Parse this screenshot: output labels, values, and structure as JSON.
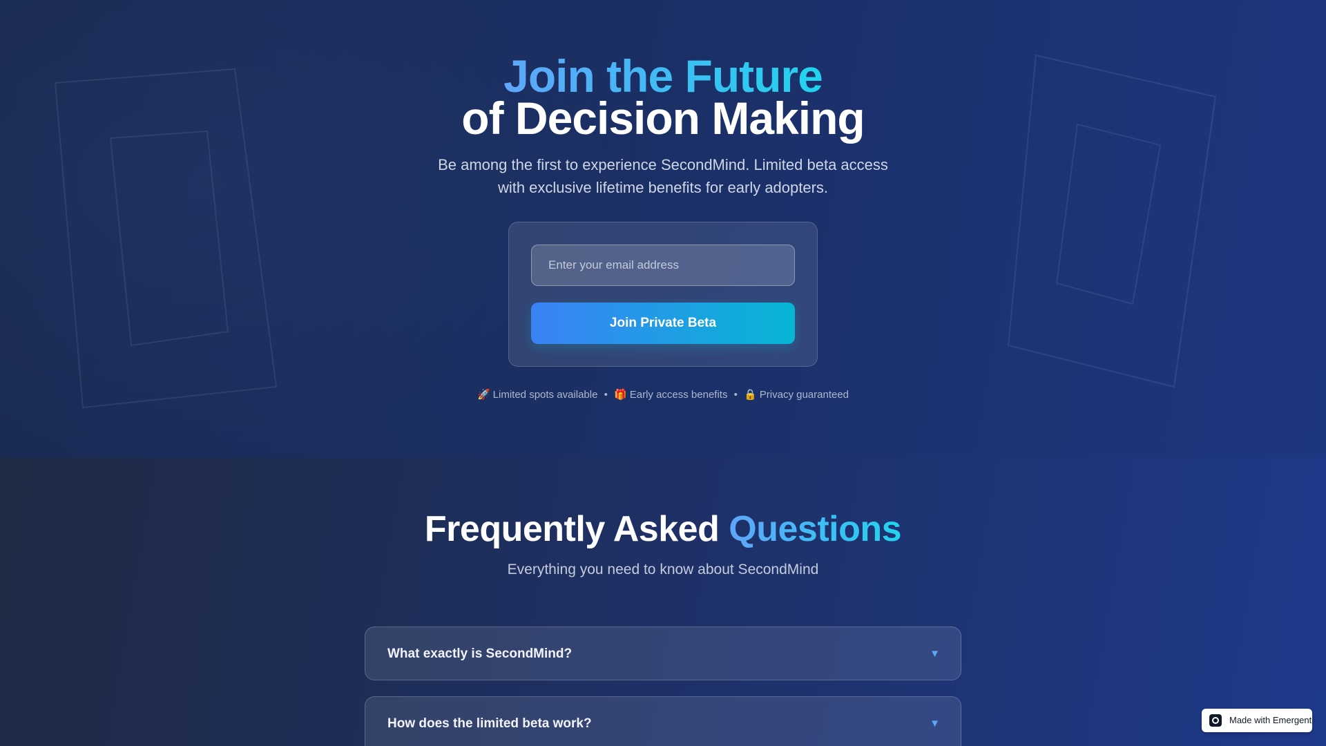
{
  "hero": {
    "title_line1": "Join the Future",
    "title_line2": "of Decision Making",
    "subtitle": "Be among the first to experience SecondMind. Limited beta access with exclusive lifetime benefits for early adopters.",
    "email_placeholder": "Enter your email address",
    "email_value": "",
    "cta_label": "Join Private Beta",
    "perks": [
      {
        "icon": "rocket-icon",
        "glyph": "🚀",
        "label": "Limited spots available"
      },
      {
        "icon": "gift-icon",
        "glyph": "🎁",
        "label": "Early access benefits"
      },
      {
        "icon": "lock-icon",
        "glyph": "🔒",
        "label": "Privacy guaranteed"
      }
    ],
    "perk_separator": "•"
  },
  "faq": {
    "title_main": "Frequently Asked",
    "title_accent": "Questions",
    "subtitle": "Everything you need to know about SecondMind",
    "items": [
      {
        "question": "What exactly is SecondMind?",
        "chevron": "▼"
      },
      {
        "question": "How does the limited beta work?",
        "chevron": "▼"
      }
    ]
  },
  "badge": {
    "label": "Made with Emergent",
    "icon": "emergent-logo-icon"
  },
  "colors": {
    "accent_blue": "#60a5fa",
    "accent_cyan": "#22d3ee",
    "button_start": "#3b82f6",
    "button_end": "#06b6d4",
    "bg_dark": "#1a2a52",
    "bg_right": "#1d3680"
  }
}
